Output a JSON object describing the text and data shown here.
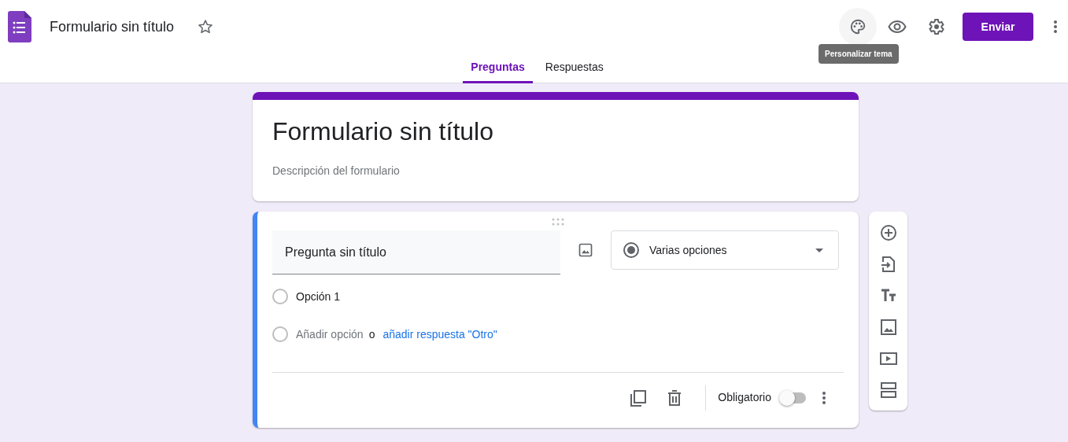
{
  "header": {
    "title": "Formulario sin título",
    "starred": false,
    "send_button": "Enviar",
    "tooltip": "Personalizar tema"
  },
  "tabs": [
    {
      "label": "Preguntas",
      "selected": true
    },
    {
      "label": "Respuestas",
      "selected": false
    }
  ],
  "form": {
    "title": "Formulario sin título",
    "description_placeholder": "Descripción del formulario"
  },
  "question": {
    "title": "Pregunta sin título",
    "type": "Varias opciones",
    "options": [
      {
        "label": "Opción 1"
      }
    ],
    "add_option": "Añadir opción",
    "separator": "o",
    "add_other": "añadir respuesta \"Otro\"",
    "required_label": "Obligatorio",
    "required": false
  }
}
